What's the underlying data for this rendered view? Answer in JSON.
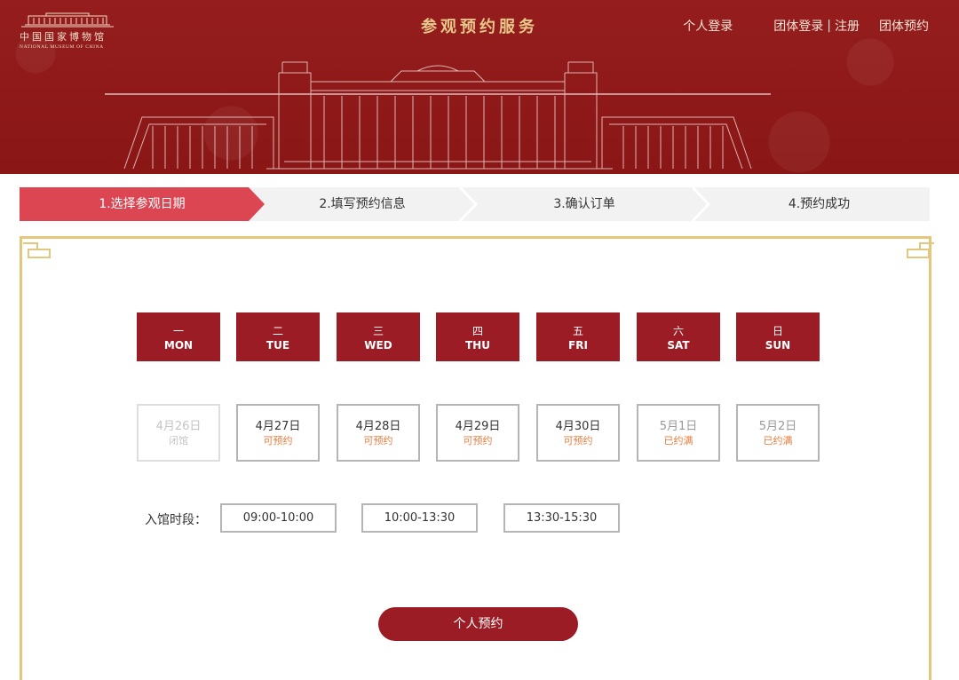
{
  "header": {
    "logo_cn": "中国国家博物馆",
    "logo_en": "NATIONAL MUSEUM OF CHINA",
    "title": "参观预约服务",
    "nav": {
      "personal_login": "个人登录",
      "group_login": "团体登录",
      "separator": "|",
      "register": "注册",
      "group_booking": "团体预约"
    }
  },
  "steps": [
    {
      "label": "1.选择参观日期",
      "active": true
    },
    {
      "label": "2.填写预约信息",
      "active": false
    },
    {
      "label": "3.确认订单",
      "active": false
    },
    {
      "label": "4.预约成功",
      "active": false
    }
  ],
  "weekdays": [
    {
      "cn": "一",
      "en": "MON"
    },
    {
      "cn": "二",
      "en": "TUE"
    },
    {
      "cn": "三",
      "en": "WED"
    },
    {
      "cn": "四",
      "en": "THU"
    },
    {
      "cn": "五",
      "en": "FRI"
    },
    {
      "cn": "六",
      "en": "SAT"
    },
    {
      "cn": "日",
      "en": "SUN"
    }
  ],
  "dates": [
    {
      "date": "4月26日",
      "status": "闭馆",
      "state": "closed"
    },
    {
      "date": "4月27日",
      "status": "可预约",
      "state": "available"
    },
    {
      "date": "4月28日",
      "status": "可预约",
      "state": "available"
    },
    {
      "date": "4月29日",
      "status": "可预约",
      "state": "available"
    },
    {
      "date": "4月30日",
      "status": "可预约",
      "state": "available"
    },
    {
      "date": "5月1日",
      "status": "已约满",
      "state": "full"
    },
    {
      "date": "5月2日",
      "status": "已约满",
      "state": "full"
    }
  ],
  "time": {
    "label": "入馆时段：",
    "slots": [
      "09:00-10:00",
      "10:00-13:30",
      "13:30-15:30"
    ]
  },
  "submit_label": "个人预约",
  "colors": {
    "header_red": "#8f1a1a",
    "accent_red": "#9b1c24",
    "active_step": "#dc4653",
    "gold": "#e3c77d",
    "available_text": "#e87d3e"
  }
}
